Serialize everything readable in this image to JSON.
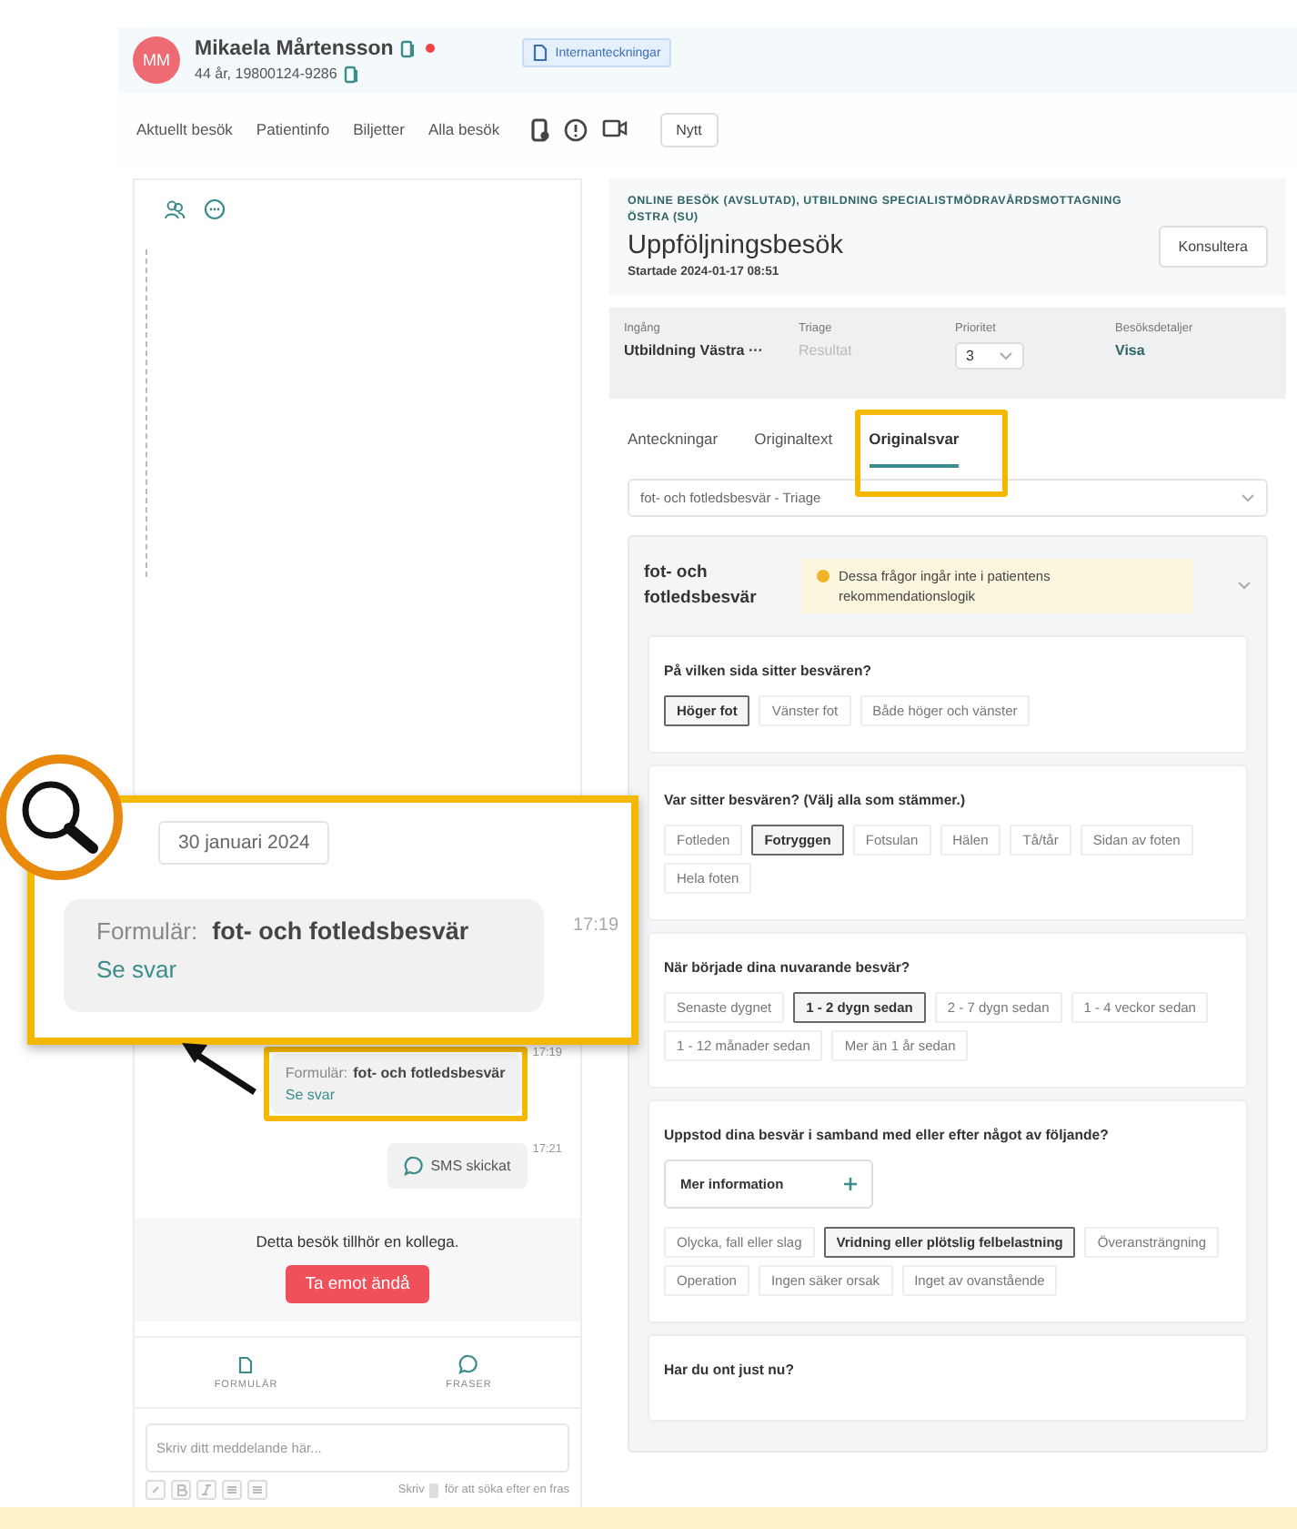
{
  "patient": {
    "initials": "MM",
    "name": "Mikaela Mårtensson",
    "age_id": "44 år, 19800124-9286",
    "notes_button": "Internanteckningar"
  },
  "nav": {
    "links": [
      "Aktuellt besök",
      "Patientinfo",
      "Biljetter",
      "Alla besök"
    ],
    "new_button": "Nytt"
  },
  "chat": {
    "form_message": {
      "label": "Formulär:",
      "title": "fot- och fotledsbesvär",
      "link": "Se svar",
      "time": "17:19"
    },
    "sms": {
      "text": "SMS skickat",
      "time": "17:21"
    },
    "notice": "Detta besök tillhör en kollega.",
    "accept_button": "Ta emot ändå",
    "tools": [
      {
        "kind": "form",
        "label": "FORMULÄR"
      },
      {
        "kind": "phrases",
        "label": "FRASER"
      }
    ],
    "composer": {
      "placeholder": "Skriv ditt meddelande här...",
      "hint_before": "Skriv",
      "hint_after": "för att söka efter en fras"
    }
  },
  "visit": {
    "category": "ONLINE BESÖK (AVSLUTAD), UTBILDNING SPECIALISTMÖDRAVÅRDSMOTTAGNING ÖSTRA (SU)",
    "title": "Uppföljningsbesök",
    "started": "Startade 2024-01-17 08:51",
    "consult_button": "Konsultera",
    "details": [
      {
        "kind": "text",
        "label": "Ingång",
        "value": "Utbildning Västra ···"
      },
      {
        "kind": "muted",
        "label": "Triage",
        "value": "Resultat"
      },
      {
        "kind": "select",
        "label": "Prioritet",
        "value": "3"
      },
      {
        "kind": "link",
        "label": "Besöksdetaljer",
        "value": "Visa"
      }
    ],
    "tabs": [
      {
        "label": "Anteckningar",
        "selected": false
      },
      {
        "label": "Originaltext",
        "selected": false
      },
      {
        "label": "Originalsvar",
        "selected": true
      }
    ],
    "form_select": "fot- och fotledsbesvär - Triage",
    "form_title": "fot- och fotledsbesvär",
    "warning": "Dessa frågor ingår inte i patientens rekommendationslogik",
    "questions": [
      {
        "question": "På vilken sida sitter besvären?",
        "options": [
          {
            "label": "Höger fot",
            "selected": true
          },
          {
            "label": "Vänster fot",
            "selected": false
          },
          {
            "label": "Både höger och vänster",
            "selected": false
          }
        ]
      },
      {
        "question": "Var sitter besvären? (Välj alla som stämmer.)",
        "options": [
          {
            "label": "Fotleden",
            "selected": false
          },
          {
            "label": "Fotryggen",
            "selected": true
          },
          {
            "label": "Fotsulan",
            "selected": false
          },
          {
            "label": "Hälen",
            "selected": false
          },
          {
            "label": "Tå/tår",
            "selected": false
          },
          {
            "label": "Sidan av foten",
            "selected": false
          },
          {
            "label": "Hela foten",
            "selected": false
          }
        ]
      },
      {
        "question": "När började dina nuvarande besvär?",
        "options": [
          {
            "label": "Senaste dygnet",
            "selected": false
          },
          {
            "label": "1 - 2 dygn sedan",
            "selected": true
          },
          {
            "label": "2 - 7 dygn sedan",
            "selected": false
          },
          {
            "label": "1 - 4 veckor sedan",
            "selected": false
          },
          {
            "label": "1 - 12 månader sedan",
            "selected": false
          },
          {
            "label": "Mer än 1 år sedan",
            "selected": false
          }
        ]
      },
      {
        "question": "Uppstod dina besvär i samband med eller efter något av följande?",
        "more_info": "Mer information",
        "options": [
          {
            "label": "Olycka, fall eller slag",
            "selected": false
          },
          {
            "label": "Vridning eller plötslig felbelastning",
            "selected": true
          },
          {
            "label": "Överansträngning",
            "selected": false
          },
          {
            "label": "Operation",
            "selected": false
          },
          {
            "label": "Ingen säker orsak",
            "selected": false
          },
          {
            "label": "Inget av ovanstående",
            "selected": false
          }
        ]
      },
      {
        "question": "Har du ont just nu?"
      }
    ]
  },
  "callout": {
    "date": "30 januari 2024",
    "label": "Formulär:",
    "title": "fot- och fotledsbesvär",
    "link": "Se svar",
    "time": "17:19"
  }
}
